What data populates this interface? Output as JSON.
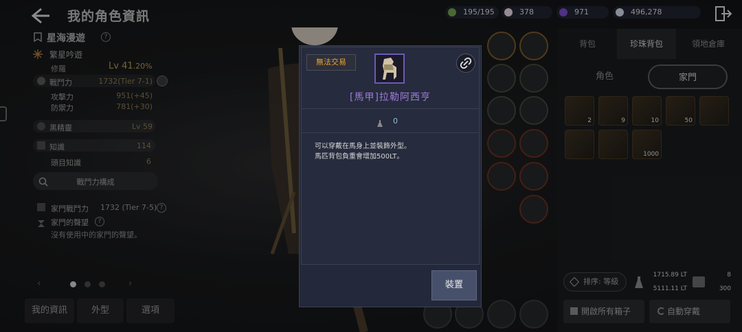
{
  "header": {
    "title": "我的角色資訊"
  },
  "resources": [
    {
      "name": "energy",
      "value": "195/195",
      "color": "#6fa34a"
    },
    {
      "name": "pearl",
      "value": "378",
      "color": "#e8d6e2"
    },
    {
      "name": "crow-coin",
      "value": "971",
      "color": "#7a4ad0"
    },
    {
      "name": "silver",
      "value": "496,278",
      "color": "#d0d8e8"
    }
  ],
  "character": {
    "family_name": "星海漫遊",
    "class_name": "繁星吟遊",
    "rank_label": "修羅",
    "level": "Lv 41",
    "level_pct": ".20%",
    "combat_power_label": "戰鬥力",
    "combat_power_value": "1732(Tier 7-1)",
    "attack_label": "攻擊力",
    "attack_value": "951(+45)",
    "defense_label": "防禦力",
    "defense_value": "781(+30)",
    "black_spirit_label": "黑精靈",
    "black_spirit_value": "Lv 59",
    "knowledge_label": "知識",
    "knowledge_value": "114",
    "head_knowledge_label": "頭目知識",
    "head_knowledge_value": "6",
    "combat_breakdown_button": "戰鬥力構成",
    "family_power_label": "家門戰鬥力",
    "family_power_value": "1732 (Tier 7-5)",
    "family_fame_label": "家門的聲望",
    "family_fame_empty": "沒有使用中的家門的聲望。"
  },
  "bottom_tabs": [
    "我的資訊",
    "外型",
    "選項"
  ],
  "inventory": {
    "tabs": [
      "背包",
      "珍珠背包",
      "領地倉庫"
    ],
    "active_tab": 1,
    "segments": [
      "角色",
      "家門"
    ],
    "active_segment": 1,
    "items": [
      {
        "name": "scroll",
        "count": "2"
      },
      {
        "name": "shield",
        "count": "9"
      },
      {
        "name": "food",
        "count": "10"
      },
      {
        "name": "potion",
        "count": "50"
      },
      {
        "name": "spear",
        "count": ""
      },
      {
        "name": "costume",
        "count": ""
      },
      {
        "name": "horse-armor",
        "count": ""
      },
      {
        "name": "feed",
        "count": "1000"
      }
    ],
    "sort_label": "排序: 等級",
    "weight_current": "1715.89 LT",
    "weight_max": "5111.11 LT",
    "slots_used": "8",
    "slots_max": "300",
    "open_all_boxes": "開啟所有箱子",
    "auto_equip": "自動穿戴"
  },
  "modal": {
    "untradable": "無法交易",
    "item_name": "[馬甲]拉勒阿西亨",
    "weight": "0",
    "description_line1": "可以穿戴在馬身上並裝飾外型。",
    "description_line2": "馬匹背包負重會增加500LT。",
    "equip_button": "裝置"
  }
}
